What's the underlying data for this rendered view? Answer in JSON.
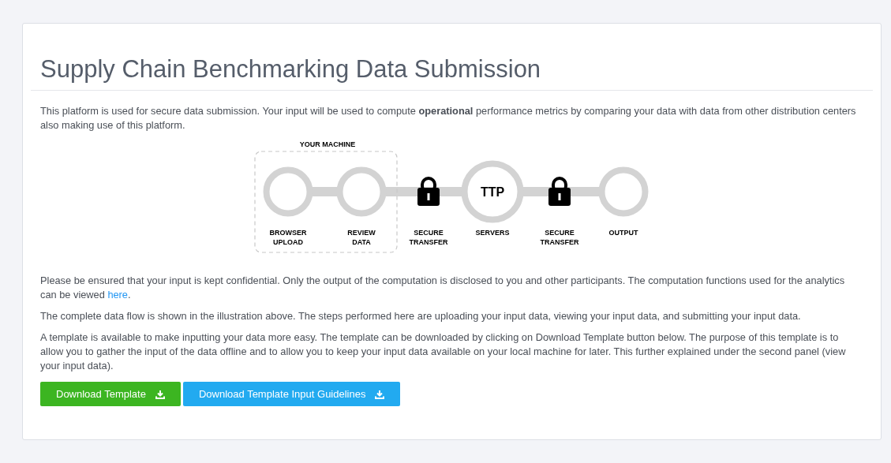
{
  "title": "Supply Chain Benchmarking Data Submission",
  "intro": "This platform is used for secure data submission. Your input will be used to compute **operational** performance metrics by comparing your data with data from other distribution centers also making use of this platform.",
  "diagram": {
    "group_label": "YOUR MACHINE",
    "steps": [
      {
        "kind": "node",
        "lines": [
          "BROWSER",
          "UPLOAD"
        ]
      },
      {
        "kind": "node",
        "lines": [
          "REVIEW",
          "DATA"
        ]
      },
      {
        "kind": "lock",
        "lines": [
          "SECURE",
          "TRANSFER"
        ]
      },
      {
        "kind": "hub",
        "center_text": "TTP",
        "lines": [
          "SERVERS"
        ]
      },
      {
        "kind": "lock",
        "lines": [
          "SECURE",
          "TRANSFER"
        ]
      },
      {
        "kind": "node",
        "lines": [
          "OUTPUT"
        ]
      }
    ]
  },
  "paragraphs": [
    {
      "text": "Please be ensured that your input is kept confidential. Only the output of the computation is disclosed to you and other participants. The computation functions used for the analytics can be viewed ",
      "link": "here",
      "after": "."
    },
    {
      "text": "The complete data flow is shown in the illustration above. The steps performed here are uploading your input data, viewing your input data, and submitting your input data."
    },
    {
      "text": "A template is available to make inputting your data more easy. The template can be downloaded by clicking on Download Template button below. The purpose of this template is to allow you to gather the input of the data offline and to allow you to keep your input data available on your local machine for later. This further explained under the second panel (view your input data)."
    }
  ],
  "buttons": [
    {
      "label": "Download Template",
      "color": "#3cb521"
    },
    {
      "label": "Download Template Input Guidelines",
      "color": "#22aaf0"
    }
  ]
}
